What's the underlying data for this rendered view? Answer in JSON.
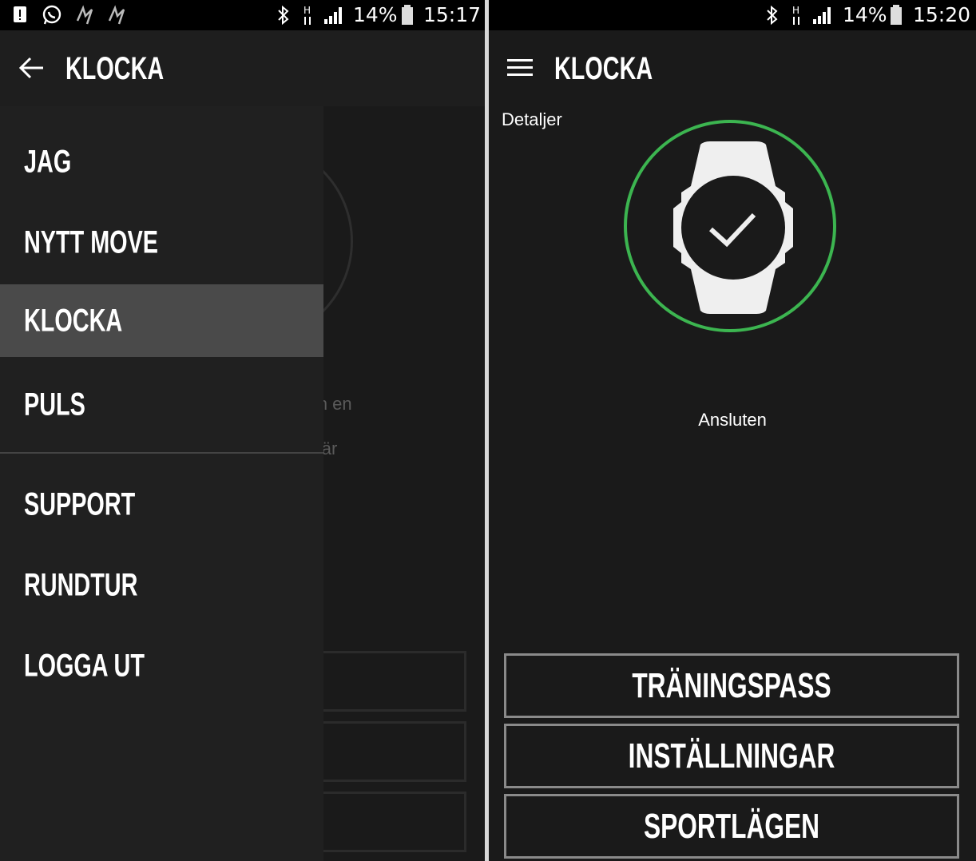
{
  "left_screen": {
    "status": {
      "battery": "14%",
      "time": "15:17"
    },
    "app_title": "KLOCKA",
    "background_text": "klocka. Om en\n upprättas,\nronisering är\n.",
    "menu": {
      "items": [
        {
          "label": "JAG"
        },
        {
          "label": "NYTT MOVE"
        },
        {
          "label": "KLOCKA",
          "active": true
        },
        {
          "label": "PULS"
        },
        {
          "label": "SUPPORT"
        },
        {
          "label": "RUNDTUR"
        },
        {
          "label": "LOGGA UT"
        }
      ]
    }
  },
  "right_screen": {
    "status": {
      "battery": "14%",
      "time": "15:20"
    },
    "app_title": "KLOCKA",
    "details_label": "Detaljer",
    "connection_status": "Ansluten",
    "buttons": [
      "TRÄNINGSPASS",
      "INSTÄLLNINGAR",
      "SPORTLÄGEN"
    ]
  },
  "colors": {
    "accent_green": "#3cb550",
    "background": "#1a1a1a",
    "drawer": "#202020",
    "active_item": "#4a4a4a"
  }
}
